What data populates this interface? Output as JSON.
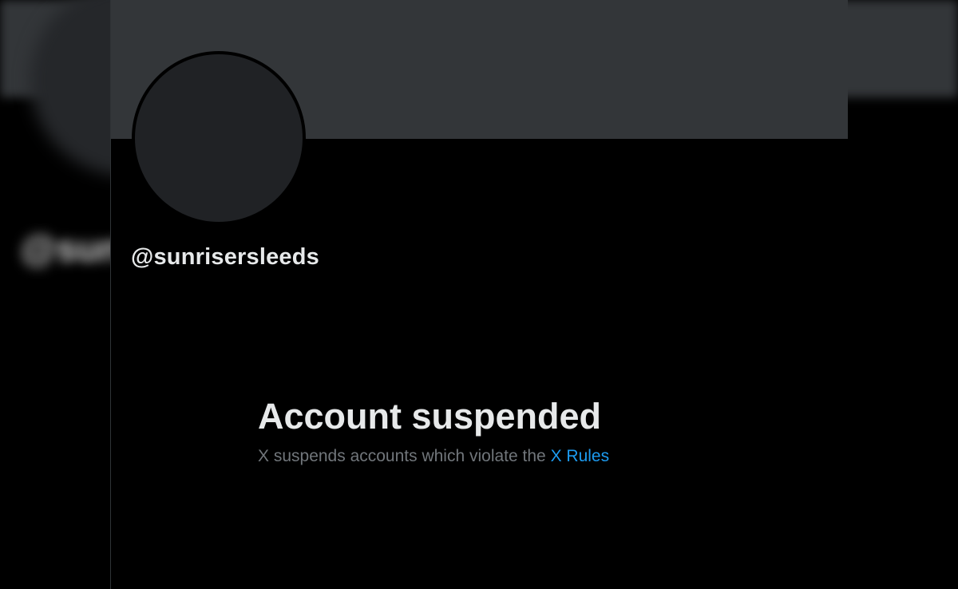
{
  "profile": {
    "handle": "@sunrisersleeds"
  },
  "background": {
    "blurred_handle": "@sunrisersleeds"
  },
  "suspension": {
    "title": "Account suspended",
    "message": "X suspends accounts which violate the",
    "link_label": "X Rules"
  },
  "colors": {
    "banner": "#333639",
    "avatar": "#202225",
    "page_background": "#000000",
    "primary_text": "#e7e9ea",
    "secondary_text": "#71767b",
    "link": "#1d9bf0"
  }
}
